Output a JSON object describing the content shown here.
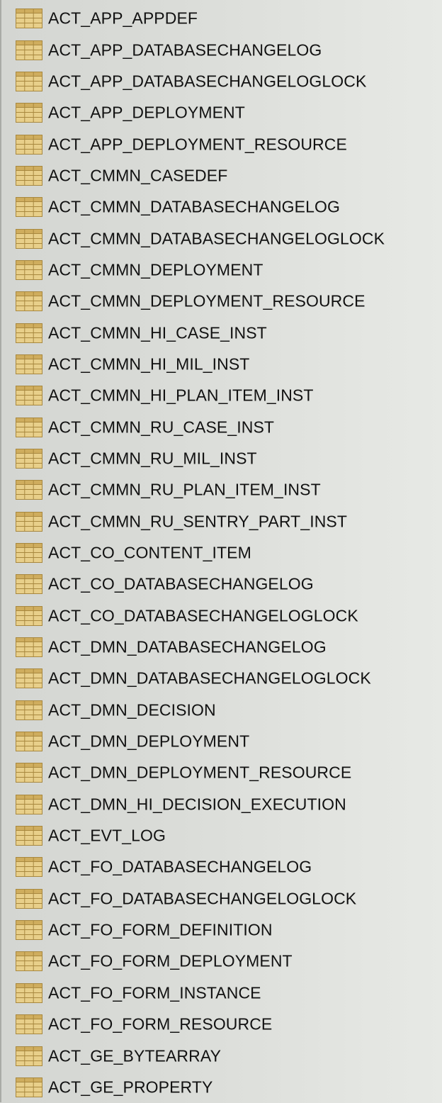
{
  "tables": [
    "ACT_APP_APPDEF",
    "ACT_APP_DATABASECHANGELOG",
    "ACT_APP_DATABASECHANGELOGLOCK",
    "ACT_APP_DEPLOYMENT",
    "ACT_APP_DEPLOYMENT_RESOURCE",
    "ACT_CMMN_CASEDEF",
    "ACT_CMMN_DATABASECHANGELOG",
    "ACT_CMMN_DATABASECHANGELOGLOCK",
    "ACT_CMMN_DEPLOYMENT",
    "ACT_CMMN_DEPLOYMENT_RESOURCE",
    "ACT_CMMN_HI_CASE_INST",
    "ACT_CMMN_HI_MIL_INST",
    "ACT_CMMN_HI_PLAN_ITEM_INST",
    "ACT_CMMN_RU_CASE_INST",
    "ACT_CMMN_RU_MIL_INST",
    "ACT_CMMN_RU_PLAN_ITEM_INST",
    "ACT_CMMN_RU_SENTRY_PART_INST",
    "ACT_CO_CONTENT_ITEM",
    "ACT_CO_DATABASECHANGELOG",
    "ACT_CO_DATABASECHANGELOGLOCK",
    "ACT_DMN_DATABASECHANGELOG",
    "ACT_DMN_DATABASECHANGELOGLOCK",
    "ACT_DMN_DECISION",
    "ACT_DMN_DEPLOYMENT",
    "ACT_DMN_DEPLOYMENT_RESOURCE",
    "ACT_DMN_HI_DECISION_EXECUTION",
    "ACT_EVT_LOG",
    "ACT_FO_DATABASECHANGELOG",
    "ACT_FO_DATABASECHANGELOGLOCK",
    "ACT_FO_FORM_DEFINITION",
    "ACT_FO_FORM_DEPLOYMENT",
    "ACT_FO_FORM_INSTANCE",
    "ACT_FO_FORM_RESOURCE",
    "ACT_GE_BYTEARRAY",
    "ACT_GE_PROPERTY"
  ],
  "icon": "table-icon",
  "colors": {
    "icon_fill": "#e8cf8a",
    "icon_header": "#cfad5e",
    "icon_border": "#a8883f",
    "text": "#111111"
  }
}
